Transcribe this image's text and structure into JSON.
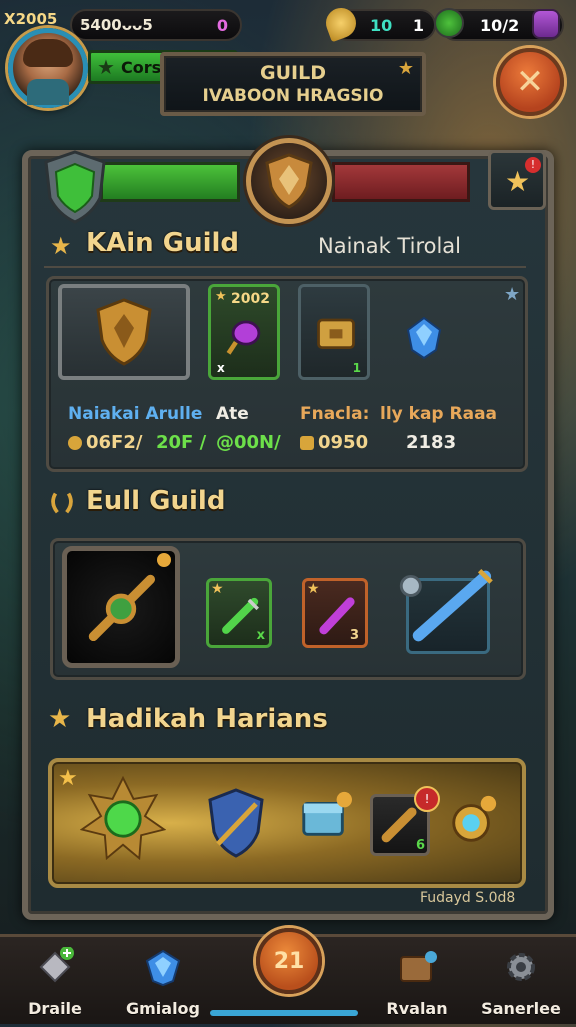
{
  "topbar": {
    "level_code": "X2005",
    "coins": "5400𝔳𝔞𝔦5",
    "coins_display": "5400ᴗᴗ5",
    "gems": "0",
    "energy": "10",
    "keys": "1",
    "slots": "10/2"
  },
  "player": {
    "level_button": "Cors Soto"
  },
  "guild_banner": {
    "line1": "GUILD",
    "line2": "IVABOON HRAGSIO"
  },
  "main_guild": {
    "title": "KAin Guild",
    "subtitle": "Nainak Tirolal",
    "stats": {
      "label1": "Naiakai Arulle",
      "label2": "Ate",
      "label3": "Fnacla:",
      "label4": "lly kap Raaa",
      "value1": "06F2/",
      "value2": "20F /",
      "value3": "@00N/",
      "value4": "0950",
      "value5": "2183"
    },
    "card_values": [
      "2002",
      "x",
      "1"
    ]
  },
  "full_guild": {
    "title": "Eull Guild",
    "card_values": [
      "x",
      "3"
    ]
  },
  "harians": {
    "title": "Hadikah Harians",
    "card_value": "6",
    "footer": "Fudayd S.0d8"
  },
  "center_button": "21",
  "bottom_nav": [
    {
      "label": "Draile"
    },
    {
      "label": "Gmialog"
    },
    {
      "label": "Rvalan"
    },
    {
      "label": "Sanerlee"
    }
  ],
  "colors": {
    "gold": "#f2d58e",
    "green": "#3fbf3a",
    "red": "#a3383a",
    "teal": "#3fe1c3",
    "accent_blue": "#3aa6d6"
  }
}
